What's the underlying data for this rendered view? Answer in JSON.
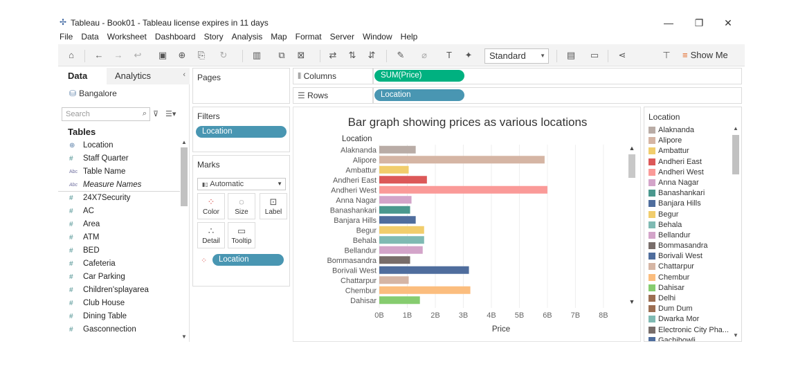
{
  "window": {
    "title": "Tableau - Book01 - Tableau license expires in 11 days",
    "menu": [
      "File",
      "Data",
      "Worksheet",
      "Dashboard",
      "Story",
      "Analysis",
      "Map",
      "Format",
      "Server",
      "Window",
      "Help"
    ]
  },
  "toolbar": {
    "view_size": "Standard",
    "show_me": "Show Me"
  },
  "data_pane": {
    "tab_data": "Data",
    "tab_analytics": "Analytics",
    "datasource": "Bangalore",
    "search_placeholder": "Search",
    "tables_heading": "Tables",
    "fields": [
      {
        "name": "Location",
        "type": "geo"
      },
      {
        "name": "Staff Quarter",
        "type": "measure"
      },
      {
        "name": "Table Name",
        "type": "abc"
      },
      {
        "name": "Measure Names",
        "type": "abc"
      },
      {
        "name": "24X7Security",
        "type": "measure"
      },
      {
        "name": "AC",
        "type": "measure"
      },
      {
        "name": "Area",
        "type": "measure"
      },
      {
        "name": "ATM",
        "type": "measure"
      },
      {
        "name": "BED",
        "type": "measure"
      },
      {
        "name": "Cafeteria",
        "type": "measure"
      },
      {
        "name": "Car Parking",
        "type": "measure"
      },
      {
        "name": "Children'splayarea",
        "type": "measure"
      },
      {
        "name": "Club House",
        "type": "measure"
      },
      {
        "name": "Dining Table",
        "type": "measure"
      },
      {
        "name": "Gasconnection",
        "type": "measure"
      }
    ]
  },
  "pages": {
    "title": "Pages"
  },
  "filters": {
    "title": "Filters",
    "pill": "Location"
  },
  "marks": {
    "title": "Marks",
    "type": "Automatic",
    "buttons": {
      "color": "Color",
      "size": "Size",
      "label": "Label",
      "detail": "Detail",
      "tooltip": "Tooltip"
    },
    "pill": "Location"
  },
  "shelves": {
    "columns_label": "Columns",
    "columns_pill": "SUM(Price)",
    "rows_label": "Rows",
    "rows_pill": "Location"
  },
  "chart_data": {
    "type": "bar",
    "title": "Bar graph showing prices as various locations",
    "row_header": "Location",
    "xlabel": "Price",
    "ylabel": "",
    "x_ticks": [
      "0B",
      "1B",
      "2B",
      "3B",
      "4B",
      "5B",
      "6B",
      "7B",
      "8B"
    ],
    "xlim": [
      0,
      8.2
    ],
    "categories": [
      "Alaknanda",
      "Alipore",
      "Ambattur",
      "Andheri East",
      "Andheri West",
      "Anna Nagar",
      "Banashankari",
      "Banjara Hills",
      "Begur",
      "Behala",
      "Bellandur",
      "Bommasandra",
      "Borivali West",
      "Chattarpur",
      "Chembur",
      "Dahisar"
    ],
    "values": [
      1.3,
      5.9,
      1.05,
      1.7,
      6.0,
      1.15,
      1.1,
      1.3,
      1.6,
      1.6,
      1.55,
      1.1,
      3.2,
      1.05,
      3.25,
      1.45
    ],
    "colors": [
      "#b9aca6",
      "#d5b5a4",
      "#f1cd6c",
      "#dc5858",
      "#fa9a98",
      "#d3a4c9",
      "#4a988e",
      "#4f6d9d",
      "#f1cd6c",
      "#7fbab3",
      "#d3a4c9",
      "#786d6a",
      "#4f6d9d",
      "#d5b5a4",
      "#fbbd7e",
      "#86cc6f"
    ]
  },
  "legend": {
    "title": "Location",
    "items": [
      {
        "name": "Alaknanda",
        "color": "#b9aca6"
      },
      {
        "name": "Alipore",
        "color": "#d5b5a4"
      },
      {
        "name": "Ambattur",
        "color": "#f1cd6c"
      },
      {
        "name": "Andheri East",
        "color": "#dc5858"
      },
      {
        "name": "Andheri West",
        "color": "#fa9a98"
      },
      {
        "name": "Anna Nagar",
        "color": "#d3a4c9"
      },
      {
        "name": "Banashankari",
        "color": "#4a988e"
      },
      {
        "name": "Banjara Hills",
        "color": "#4f6d9d"
      },
      {
        "name": "Begur",
        "color": "#f1cd6c"
      },
      {
        "name": "Behala",
        "color": "#7fbab3"
      },
      {
        "name": "Bellandur",
        "color": "#d3a4c9"
      },
      {
        "name": "Bommasandra",
        "color": "#786d6a"
      },
      {
        "name": "Borivali West",
        "color": "#4f6d9d"
      },
      {
        "name": "Chattarpur",
        "color": "#d5b5a4"
      },
      {
        "name": "Chembur",
        "color": "#fbbd7e"
      },
      {
        "name": "Dahisar",
        "color": "#86cc6f"
      },
      {
        "name": "Delhi",
        "color": "#9c6e52"
      },
      {
        "name": "Dum Dum",
        "color": "#9c6e52"
      },
      {
        "name": "Dwarka Mor",
        "color": "#7fbab3"
      },
      {
        "name": "Electronic City Pha...",
        "color": "#786d6a"
      },
      {
        "name": "Gachibowli",
        "color": "#4f6d9d"
      }
    ]
  }
}
